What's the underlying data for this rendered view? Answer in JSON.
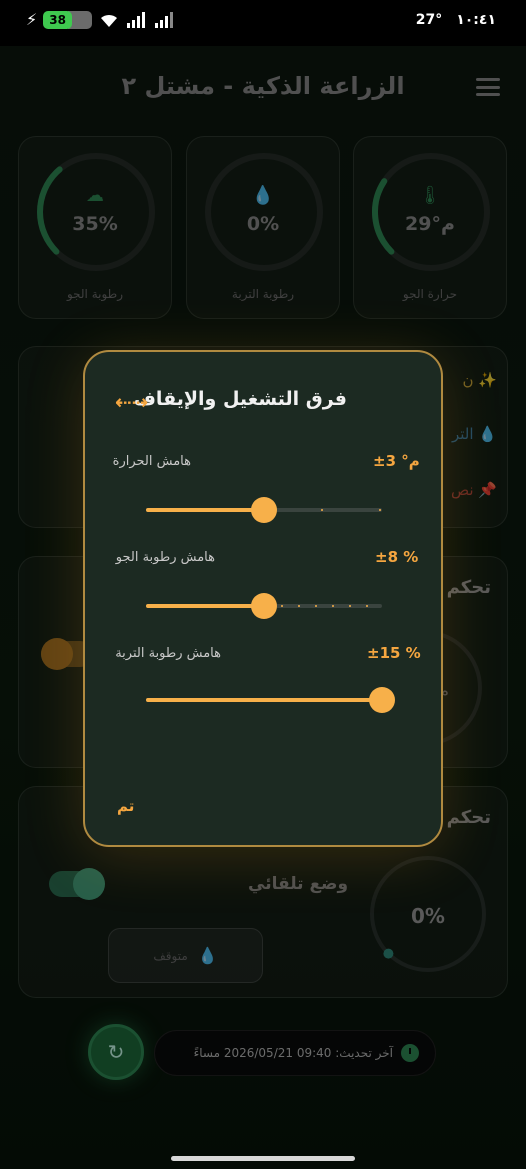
{
  "status_bar": {
    "battery": "38",
    "temp": "27°",
    "time": "١٠:٤١"
  },
  "header": {
    "title": "الزراعة الذكية - مشتل ٢"
  },
  "gauges": [
    {
      "label": "حرارة الجو",
      "value": "29°م",
      "icon": "thermometer-icon",
      "fraction": 0.29,
      "color": "#2f8a55"
    },
    {
      "label": "رطوبة التربة",
      "value": "0%",
      "icon": "water-drop-icon",
      "fraction": 0.0,
      "color": "#b03030"
    },
    {
      "label": "رطوبة الجو",
      "value": "35%",
      "icon": "cloud-icon",
      "fraction": 0.35,
      "color": "#2f8a55"
    }
  ],
  "info_card": {
    "line1": "ن",
    "line2": "التر",
    "line3": "نص"
  },
  "control_card_1": {
    "title": "تحكم",
    "gauge_partial": "م"
  },
  "control_card_2": {
    "title": "تحكم",
    "auto_mode_label": "وضع تلقائي",
    "stop_label": "متوقف",
    "pump_value": "0%"
  },
  "modal": {
    "title": "فرق التشغيل والإيقاف",
    "rows": [
      {
        "label": "هامش الحرارة",
        "value": "±3 °م",
        "fraction": 0.5
      },
      {
        "label": "هامش رطوبة الجو",
        "value": "±8 %",
        "fraction": 0.5
      },
      {
        "label": "هامش رطوبة التربة",
        "value": "±15 %",
        "fraction": 1.0
      }
    ],
    "done_label": "تم"
  },
  "footer": {
    "last_update": "آخر تحديث: 09:40 2026/05/21 مساءً"
  },
  "colors": {
    "accent_orange": "#f5a640",
    "accent_green": "#2f8a55"
  }
}
